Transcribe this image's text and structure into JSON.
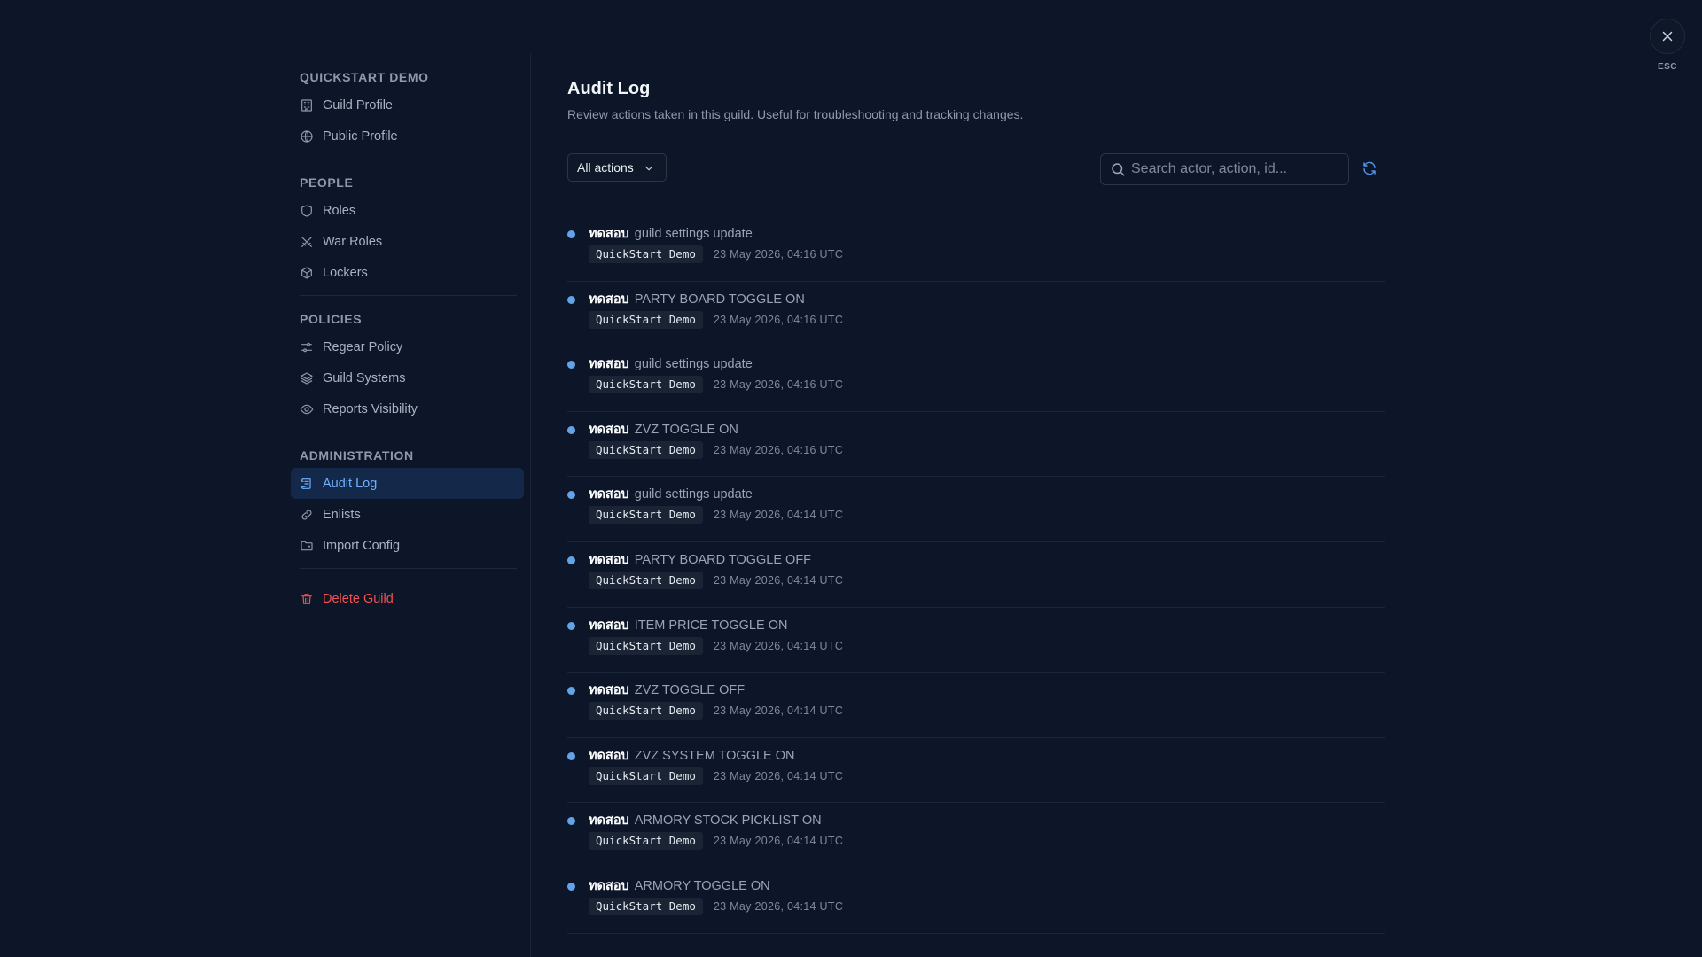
{
  "close": {
    "esc_label": "ESC",
    "icon": "close-icon"
  },
  "sidebar": {
    "groups": [
      {
        "heading": "QUICKSTART DEMO",
        "items": [
          {
            "label": "Guild Profile",
            "icon": "building-icon"
          },
          {
            "label": "Public Profile",
            "icon": "globe-icon"
          }
        ]
      },
      {
        "heading": "PEOPLE",
        "items": [
          {
            "label": "Roles",
            "icon": "shield-icon"
          },
          {
            "label": "War Roles",
            "icon": "crossed-swords-icon"
          },
          {
            "label": "Lockers",
            "icon": "box-icon"
          }
        ]
      },
      {
        "heading": "POLICIES",
        "items": [
          {
            "label": "Regear Policy",
            "icon": "sliders-icon"
          },
          {
            "label": "Guild Systems",
            "icon": "layers-icon"
          },
          {
            "label": "Reports Visibility",
            "icon": "eye-icon"
          }
        ]
      },
      {
        "heading": "ADMINISTRATION",
        "items": [
          {
            "label": "Audit Log",
            "icon": "scroll-icon",
            "active": true
          },
          {
            "label": "Enlists",
            "icon": "link-icon"
          },
          {
            "label": "Import Config",
            "icon": "folder-icon"
          }
        ]
      }
    ],
    "delete_label": "Delete Guild",
    "accent_color": "#6fb1ff",
    "danger_color": "#f0524d"
  },
  "main": {
    "title": "Audit Log",
    "description": "Review actions taken in this guild. Useful for troubleshooting and tracking changes.",
    "filter": {
      "selected": "All actions"
    },
    "search": {
      "placeholder": "Search actor, action, id...",
      "value": ""
    },
    "log": [
      {
        "actor": "ทดสอบ",
        "action": "guild settings update",
        "guild": "QuickStart Demo",
        "time": "23 May 2026, 04:16 UTC"
      },
      {
        "actor": "ทดสอบ",
        "action": "PARTY BOARD TOGGLE ON",
        "guild": "QuickStart Demo",
        "time": "23 May 2026, 04:16 UTC"
      },
      {
        "actor": "ทดสอบ",
        "action": "guild settings update",
        "guild": "QuickStart Demo",
        "time": "23 May 2026, 04:16 UTC"
      },
      {
        "actor": "ทดสอบ",
        "action": "ZVZ TOGGLE ON",
        "guild": "QuickStart Demo",
        "time": "23 May 2026, 04:16 UTC"
      },
      {
        "actor": "ทดสอบ",
        "action": "guild settings update",
        "guild": "QuickStart Demo",
        "time": "23 May 2026, 04:14 UTC"
      },
      {
        "actor": "ทดสอบ",
        "action": "PARTY BOARD TOGGLE OFF",
        "guild": "QuickStart Demo",
        "time": "23 May 2026, 04:14 UTC"
      },
      {
        "actor": "ทดสอบ",
        "action": "ITEM PRICE TOGGLE ON",
        "guild": "QuickStart Demo",
        "time": "23 May 2026, 04:14 UTC"
      },
      {
        "actor": "ทดสอบ",
        "action": "ZVZ TOGGLE OFF",
        "guild": "QuickStart Demo",
        "time": "23 May 2026, 04:14 UTC"
      },
      {
        "actor": "ทดสอบ",
        "action": "ZVZ SYSTEM TOGGLE ON",
        "guild": "QuickStart Demo",
        "time": "23 May 2026, 04:14 UTC"
      },
      {
        "actor": "ทดสอบ",
        "action": "ARMORY STOCK PICKLIST ON",
        "guild": "QuickStart Demo",
        "time": "23 May 2026, 04:14 UTC"
      },
      {
        "actor": "ทดสอบ",
        "action": "ARMORY TOGGLE ON",
        "guild": "QuickStart Demo",
        "time": "23 May 2026, 04:14 UTC"
      }
    ]
  }
}
